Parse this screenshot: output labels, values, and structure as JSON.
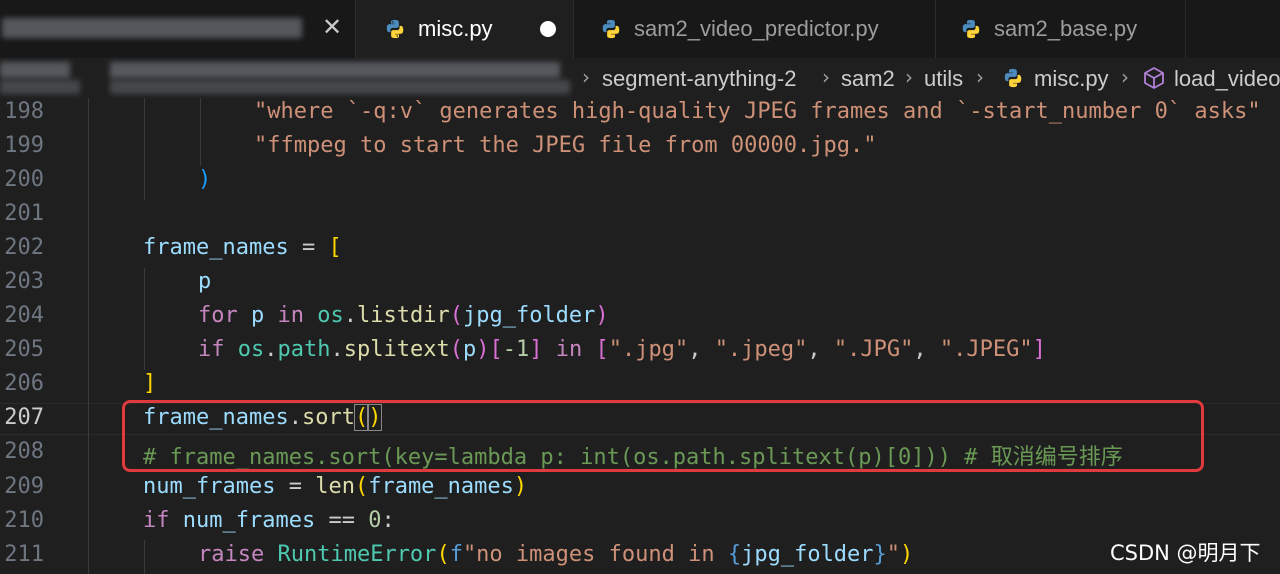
{
  "tabs": [
    {
      "label": "misc.py"
    },
    {
      "label": "sam2_video_predictor.py"
    },
    {
      "label": "sam2_base.py"
    }
  ],
  "breadcrumb": {
    "items": [
      "segment-anything-2",
      "sam2",
      "utils",
      "misc.py",
      "load_video"
    ]
  },
  "line_numbers": [
    "198",
    "199",
    "200",
    "201",
    "202",
    "203",
    "204",
    "205",
    "206",
    "207",
    "208",
    "209",
    "210",
    "211"
  ],
  "code": {
    "l198": {
      "a": "\"where `-q:v` generates high-quality JPEG frames and `-start_number 0` asks\""
    },
    "l199": {
      "a": "\"ffmpeg to start the JPEG file from 00000.jpg.\""
    },
    "l200": {
      "a": ")"
    },
    "l202": {
      "a": "frame_names",
      "b": " = ",
      "c": "["
    },
    "l203": {
      "a": "p"
    },
    "l204": {
      "a": "for",
      "b": "p",
      "c": "in",
      "d": "os",
      "e": "listdir",
      "f": "(",
      "g": "jpg_folder",
      "h": ")"
    },
    "l205": {
      "a": "if",
      "b": "os",
      "c": "path",
      "d": "splitext",
      "e": "(",
      "f": "p",
      "g": ")",
      "h": "[",
      "i": "-1",
      "j": "]",
      "k": "in",
      "l": "[",
      "m": "\".jpg\"",
      "n": "\".jpeg\"",
      "o": "\".JPG\"",
      "p": "\".JPEG\"",
      "q": "]"
    },
    "l206": {
      "a": "]"
    },
    "l207": {
      "a": "frame_names",
      "b": "sort",
      "c": "(",
      "d": ")"
    },
    "l208": {
      "a": "# frame_names.sort(key=lambda p: int(os.path.splitext(p)[0])) # 取消编号排序"
    },
    "l209": {
      "a": "num_frames",
      "b": " = ",
      "c": "len",
      "d": "(",
      "e": "frame_names",
      "f": ")"
    },
    "l210": {
      "a": "if",
      "b": "num_frames",
      "c": " == ",
      "d": "0",
      "e": ":"
    },
    "l211": {
      "a": "raise",
      "b": "RuntimeError",
      "c": "(",
      "d": "f",
      "e": "\"no images found in ",
      "f": "{",
      "g": "jpg_folder",
      "h": "}",
      "i": "\"",
      "j": ")"
    }
  },
  "watermark": "CSDN @明月下",
  "colors": {
    "highlight_box": "#e0393e",
    "string": "#ce9178",
    "keyword": "#c586c0",
    "comment": "#6a9955"
  }
}
